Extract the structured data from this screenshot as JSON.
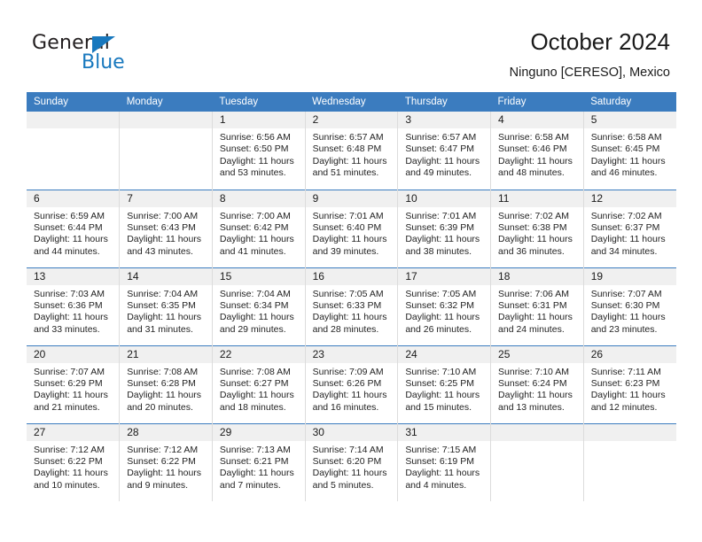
{
  "brand": {
    "name_top": "General",
    "name_bottom": "Blue",
    "triangle_color": "#1878be",
    "text_color": "#231f20"
  },
  "header": {
    "title": "October 2024",
    "subtitle": "Ninguno [CERESO], Mexico"
  },
  "theme": {
    "header_blue": "#3b7cbf",
    "daynum_band": "#f0f0f0",
    "cell_divider": "#dcdcdc",
    "text": "#232323"
  },
  "calendar": {
    "weekday_headers": [
      "Sunday",
      "Monday",
      "Tuesday",
      "Wednesday",
      "Thursday",
      "Friday",
      "Saturday"
    ],
    "labels": {
      "sunrise": "Sunrise:",
      "sunset": "Sunset:",
      "daylight": "Daylight:"
    },
    "weeks": [
      [
        {
          "empty": true
        },
        {
          "empty": true
        },
        {
          "day": "1",
          "sunrise": "Sunrise: 6:56 AM",
          "sunset": "Sunset: 6:50 PM",
          "daylight1": "Daylight: 11 hours",
          "daylight2": "and 53 minutes."
        },
        {
          "day": "2",
          "sunrise": "Sunrise: 6:57 AM",
          "sunset": "Sunset: 6:48 PM",
          "daylight1": "Daylight: 11 hours",
          "daylight2": "and 51 minutes."
        },
        {
          "day": "3",
          "sunrise": "Sunrise: 6:57 AM",
          "sunset": "Sunset: 6:47 PM",
          "daylight1": "Daylight: 11 hours",
          "daylight2": "and 49 minutes."
        },
        {
          "day": "4",
          "sunrise": "Sunrise: 6:58 AM",
          "sunset": "Sunset: 6:46 PM",
          "daylight1": "Daylight: 11 hours",
          "daylight2": "and 48 minutes."
        },
        {
          "day": "5",
          "sunrise": "Sunrise: 6:58 AM",
          "sunset": "Sunset: 6:45 PM",
          "daylight1": "Daylight: 11 hours",
          "daylight2": "and 46 minutes."
        }
      ],
      [
        {
          "day": "6",
          "sunrise": "Sunrise: 6:59 AM",
          "sunset": "Sunset: 6:44 PM",
          "daylight1": "Daylight: 11 hours",
          "daylight2": "and 44 minutes."
        },
        {
          "day": "7",
          "sunrise": "Sunrise: 7:00 AM",
          "sunset": "Sunset: 6:43 PM",
          "daylight1": "Daylight: 11 hours",
          "daylight2": "and 43 minutes."
        },
        {
          "day": "8",
          "sunrise": "Sunrise: 7:00 AM",
          "sunset": "Sunset: 6:42 PM",
          "daylight1": "Daylight: 11 hours",
          "daylight2": "and 41 minutes."
        },
        {
          "day": "9",
          "sunrise": "Sunrise: 7:01 AM",
          "sunset": "Sunset: 6:40 PM",
          "daylight1": "Daylight: 11 hours",
          "daylight2": "and 39 minutes."
        },
        {
          "day": "10",
          "sunrise": "Sunrise: 7:01 AM",
          "sunset": "Sunset: 6:39 PM",
          "daylight1": "Daylight: 11 hours",
          "daylight2": "and 38 minutes."
        },
        {
          "day": "11",
          "sunrise": "Sunrise: 7:02 AM",
          "sunset": "Sunset: 6:38 PM",
          "daylight1": "Daylight: 11 hours",
          "daylight2": "and 36 minutes."
        },
        {
          "day": "12",
          "sunrise": "Sunrise: 7:02 AM",
          "sunset": "Sunset: 6:37 PM",
          "daylight1": "Daylight: 11 hours",
          "daylight2": "and 34 minutes."
        }
      ],
      [
        {
          "day": "13",
          "sunrise": "Sunrise: 7:03 AM",
          "sunset": "Sunset: 6:36 PM",
          "daylight1": "Daylight: 11 hours",
          "daylight2": "and 33 minutes."
        },
        {
          "day": "14",
          "sunrise": "Sunrise: 7:04 AM",
          "sunset": "Sunset: 6:35 PM",
          "daylight1": "Daylight: 11 hours",
          "daylight2": "and 31 minutes."
        },
        {
          "day": "15",
          "sunrise": "Sunrise: 7:04 AM",
          "sunset": "Sunset: 6:34 PM",
          "daylight1": "Daylight: 11 hours",
          "daylight2": "and 29 minutes."
        },
        {
          "day": "16",
          "sunrise": "Sunrise: 7:05 AM",
          "sunset": "Sunset: 6:33 PM",
          "daylight1": "Daylight: 11 hours",
          "daylight2": "and 28 minutes."
        },
        {
          "day": "17",
          "sunrise": "Sunrise: 7:05 AM",
          "sunset": "Sunset: 6:32 PM",
          "daylight1": "Daylight: 11 hours",
          "daylight2": "and 26 minutes."
        },
        {
          "day": "18",
          "sunrise": "Sunrise: 7:06 AM",
          "sunset": "Sunset: 6:31 PM",
          "daylight1": "Daylight: 11 hours",
          "daylight2": "and 24 minutes."
        },
        {
          "day": "19",
          "sunrise": "Sunrise: 7:07 AM",
          "sunset": "Sunset: 6:30 PM",
          "daylight1": "Daylight: 11 hours",
          "daylight2": "and 23 minutes."
        }
      ],
      [
        {
          "day": "20",
          "sunrise": "Sunrise: 7:07 AM",
          "sunset": "Sunset: 6:29 PM",
          "daylight1": "Daylight: 11 hours",
          "daylight2": "and 21 minutes."
        },
        {
          "day": "21",
          "sunrise": "Sunrise: 7:08 AM",
          "sunset": "Sunset: 6:28 PM",
          "daylight1": "Daylight: 11 hours",
          "daylight2": "and 20 minutes."
        },
        {
          "day": "22",
          "sunrise": "Sunrise: 7:08 AM",
          "sunset": "Sunset: 6:27 PM",
          "daylight1": "Daylight: 11 hours",
          "daylight2": "and 18 minutes."
        },
        {
          "day": "23",
          "sunrise": "Sunrise: 7:09 AM",
          "sunset": "Sunset: 6:26 PM",
          "daylight1": "Daylight: 11 hours",
          "daylight2": "and 16 minutes."
        },
        {
          "day": "24",
          "sunrise": "Sunrise: 7:10 AM",
          "sunset": "Sunset: 6:25 PM",
          "daylight1": "Daylight: 11 hours",
          "daylight2": "and 15 minutes."
        },
        {
          "day": "25",
          "sunrise": "Sunrise: 7:10 AM",
          "sunset": "Sunset: 6:24 PM",
          "daylight1": "Daylight: 11 hours",
          "daylight2": "and 13 minutes."
        },
        {
          "day": "26",
          "sunrise": "Sunrise: 7:11 AM",
          "sunset": "Sunset: 6:23 PM",
          "daylight1": "Daylight: 11 hours",
          "daylight2": "and 12 minutes."
        }
      ],
      [
        {
          "day": "27",
          "sunrise": "Sunrise: 7:12 AM",
          "sunset": "Sunset: 6:22 PM",
          "daylight1": "Daylight: 11 hours",
          "daylight2": "and 10 minutes."
        },
        {
          "day": "28",
          "sunrise": "Sunrise: 7:12 AM",
          "sunset": "Sunset: 6:22 PM",
          "daylight1": "Daylight: 11 hours",
          "daylight2": "and 9 minutes."
        },
        {
          "day": "29",
          "sunrise": "Sunrise: 7:13 AM",
          "sunset": "Sunset: 6:21 PM",
          "daylight1": "Daylight: 11 hours",
          "daylight2": "and 7 minutes."
        },
        {
          "day": "30",
          "sunrise": "Sunrise: 7:14 AM",
          "sunset": "Sunset: 6:20 PM",
          "daylight1": "Daylight: 11 hours",
          "daylight2": "and 5 minutes."
        },
        {
          "day": "31",
          "sunrise": "Sunrise: 7:15 AM",
          "sunset": "Sunset: 6:19 PM",
          "daylight1": "Daylight: 11 hours",
          "daylight2": "and 4 minutes."
        },
        {
          "empty": true
        },
        {
          "empty": true
        }
      ]
    ]
  }
}
